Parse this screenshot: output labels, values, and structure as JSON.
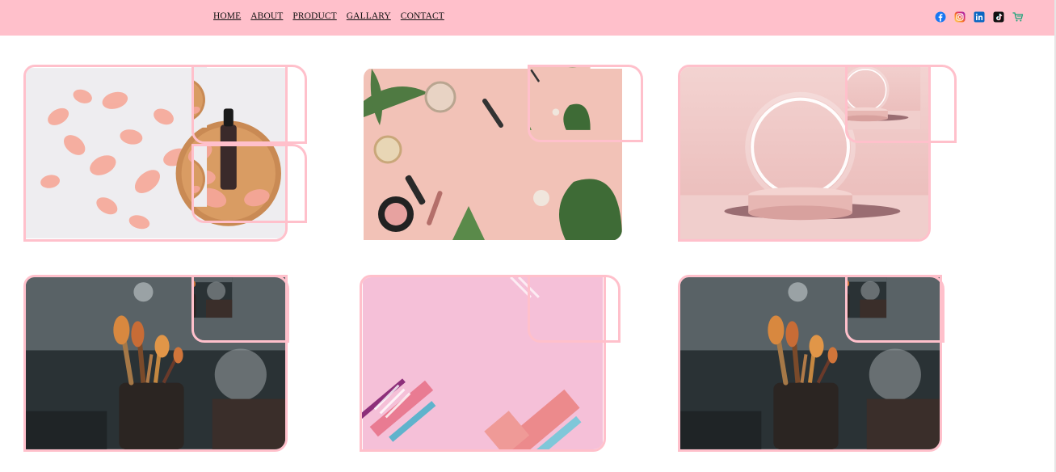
{
  "nav": {
    "links": [
      {
        "label": "HOME"
      },
      {
        "label": "ABOUT"
      },
      {
        "label": "PRODUCT"
      },
      {
        "label": "GALLARY"
      },
      {
        "label": "CONTACT"
      }
    ],
    "socials": [
      "facebook-icon",
      "instagram-icon",
      "linkedin-icon",
      "tiktok-icon",
      "cart-icon"
    ]
  },
  "colors": {
    "navbar": "#ffc0cb",
    "card_border": "#ffc0cb",
    "facebook": "#1877f2",
    "instagram": "#d62976",
    "linkedin": "#0a66c2",
    "tiktok": "#111111",
    "cart": "#1aa37a"
  },
  "gallery": {
    "images": [
      {
        "subject": "rose petals and serum bottle"
      },
      {
        "subject": "makeup flat lay with palm leaves"
      },
      {
        "subject": "glowing ring podium"
      },
      {
        "subject": "makeup brushes in cup"
      },
      {
        "subject": "pink abstract background"
      },
      {
        "subject": "makeup brushes in cup"
      }
    ]
  }
}
